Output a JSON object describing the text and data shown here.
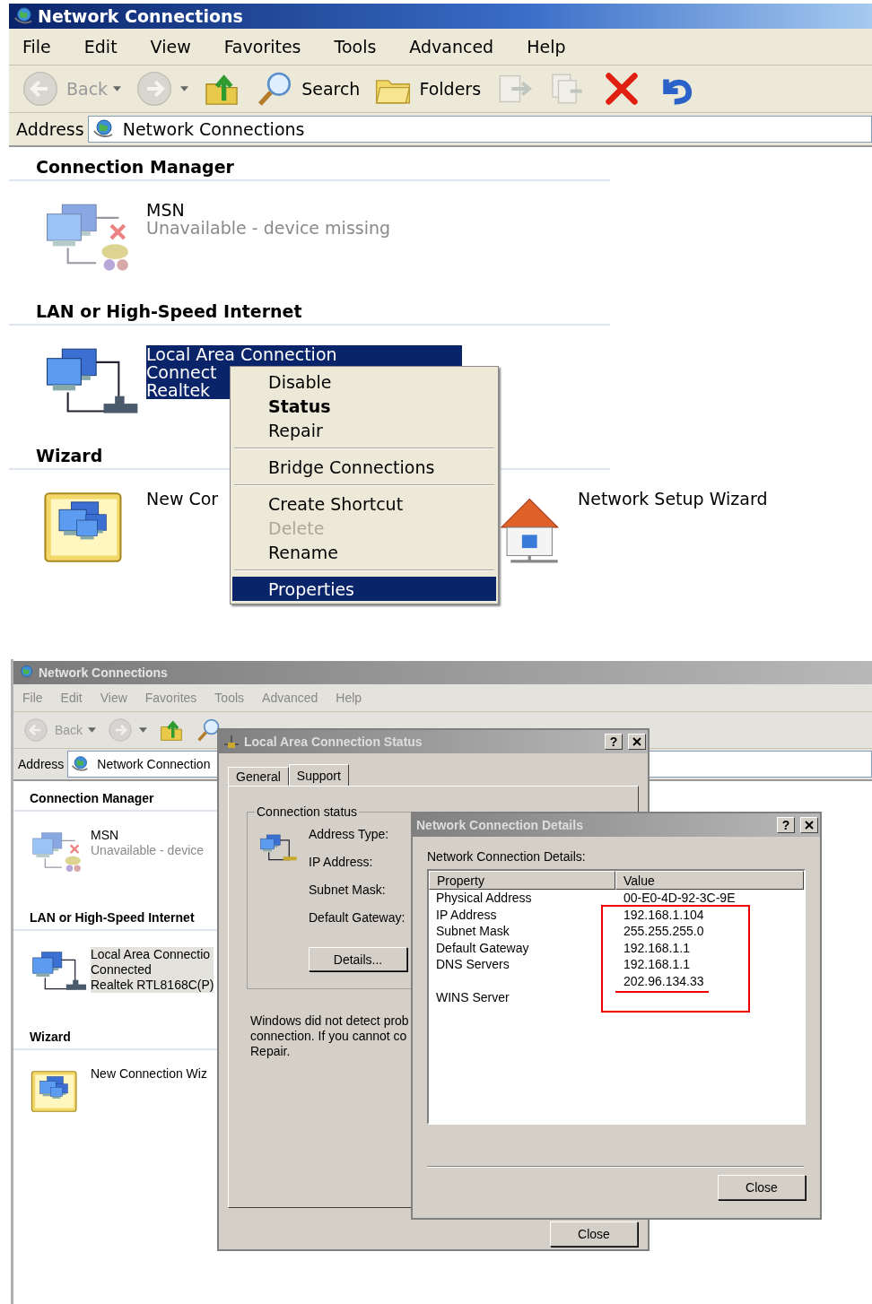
{
  "screens": [
    {
      "window": {
        "title": "Network Connections",
        "active": true
      },
      "menu": [
        "File",
        "Edit",
        "View",
        "Favorites",
        "Tools",
        "Advanced",
        "Help"
      ],
      "toolbar": [
        {
          "kind": "back",
          "label": "Back",
          "disabled": true
        },
        {
          "kind": "forward",
          "disabled": true
        },
        {
          "kind": "up",
          "disabled": false
        },
        {
          "kind": "search",
          "label": "Search",
          "disabled": false
        },
        {
          "kind": "folders",
          "label": "Folders",
          "disabled": false
        },
        {
          "kind": "move",
          "disabled": true
        },
        {
          "kind": "copy",
          "disabled": true
        },
        {
          "kind": "delete",
          "disabled": false
        },
        {
          "kind": "undo",
          "disabled": false
        }
      ],
      "address": {
        "label": "Address",
        "value": "Network Connections"
      },
      "groups": [
        {
          "title": "Connection Manager",
          "items": [
            {
              "kind": "msn",
              "name": "MSN",
              "details": [
                "Unavailable - device missing"
              ],
              "available": false,
              "selected": false
            }
          ]
        },
        {
          "title": "LAN or High-Speed Internet",
          "items": [
            {
              "kind": "lan",
              "name": "Local Area Connection",
              "details": [
                "Connect",
                "Realtek"
              ],
              "available": true,
              "selected": true
            }
          ]
        },
        {
          "title": "Wizard",
          "items": [
            {
              "kind": "new-connection",
              "name": "New Cor",
              "selected": false
            },
            {
              "kind": "setup",
              "name": "Network Setup Wizard",
              "selected": false
            }
          ]
        }
      ],
      "context_menu": {
        "items": [
          {
            "kind": "item",
            "label": "Disable",
            "default": false,
            "disabled": false,
            "selected": false
          },
          {
            "kind": "item",
            "label": "Status",
            "default": true,
            "disabled": false,
            "selected": false
          },
          {
            "kind": "item",
            "label": "Repair",
            "default": false,
            "disabled": false,
            "selected": false
          },
          {
            "kind": "separator"
          },
          {
            "kind": "item",
            "label": "Bridge Connections",
            "default": false,
            "disabled": false,
            "selected": false
          },
          {
            "kind": "separator"
          },
          {
            "kind": "item",
            "label": "Create Shortcut",
            "default": false,
            "disabled": false,
            "selected": false
          },
          {
            "kind": "item",
            "label": "Delete",
            "default": false,
            "disabled": true,
            "selected": false
          },
          {
            "kind": "item",
            "label": "Rename",
            "default": false,
            "disabled": false,
            "selected": false
          },
          {
            "kind": "separator"
          },
          {
            "kind": "item",
            "label": "Properties",
            "default": false,
            "disabled": false,
            "selected": true
          }
        ]
      }
    },
    {
      "window": {
        "title": "Network Connections",
        "active": false
      },
      "menu": [
        "File",
        "Edit",
        "View",
        "Favorites",
        "Tools",
        "Advanced",
        "Help"
      ],
      "toolbar": [
        {
          "kind": "back",
          "label": "Back",
          "disabled": true
        },
        {
          "kind": "forward",
          "disabled": true
        },
        {
          "kind": "up",
          "disabled": false
        },
        {
          "kind": "search",
          "disabled": false
        }
      ],
      "address": {
        "label": "Address",
        "value": "Network Connection"
      },
      "groups": [
        {
          "title": "Connection Manager",
          "items": [
            {
              "kind": "msn",
              "name": "MSN",
              "details": [
                "Unavailable - device"
              ],
              "available": false,
              "selected": false
            }
          ]
        },
        {
          "title": "LAN or High-Speed Internet",
          "items": [
            {
              "kind": "lan",
              "name": "Local Area Connectio",
              "details": [
                "Connected",
                "Realtek RTL8168C(P)"
              ],
              "available": true,
              "selected": true
            }
          ]
        },
        {
          "title": "Wizard",
          "items": [
            {
              "kind": "new-connection",
              "name": "New Connection Wiz",
              "selected": false
            }
          ]
        }
      ],
      "status_dialog": {
        "title": "Local Area Connection Status",
        "active": false,
        "help": "?",
        "tabs": [
          {
            "label": "General",
            "selected": false
          },
          {
            "label": "Support",
            "selected": true
          }
        ],
        "group_title": "Connection status",
        "fields": [
          "Address Type:",
          "IP Address:",
          "Subnet Mask:",
          "Default Gateway:"
        ],
        "details_button": "Details...",
        "message": [
          "Windows did not detect prob",
          "connection. If you cannot co",
          "Repair."
        ],
        "close_button": "Close"
      },
      "details_dialog": {
        "title": "Network Connection Details",
        "active": false,
        "help": "?",
        "label": "Network Connection Details:",
        "columns": [
          "Property",
          "Value"
        ],
        "rows": [
          {
            "property": "Physical Address",
            "value": "00-E0-4D-92-3C-9E"
          },
          {
            "property": "IP Address",
            "value": "192.168.1.104"
          },
          {
            "property": "Subnet Mask",
            "value": "255.255.255.0"
          },
          {
            "property": "Default Gateway",
            "value": "192.168.1.1"
          },
          {
            "property": "DNS Servers",
            "value": "192.168.1.1"
          },
          {
            "value": "202.96.134.33"
          },
          {
            "property": "WINS Server"
          }
        ],
        "close_button": "Close"
      }
    }
  ]
}
